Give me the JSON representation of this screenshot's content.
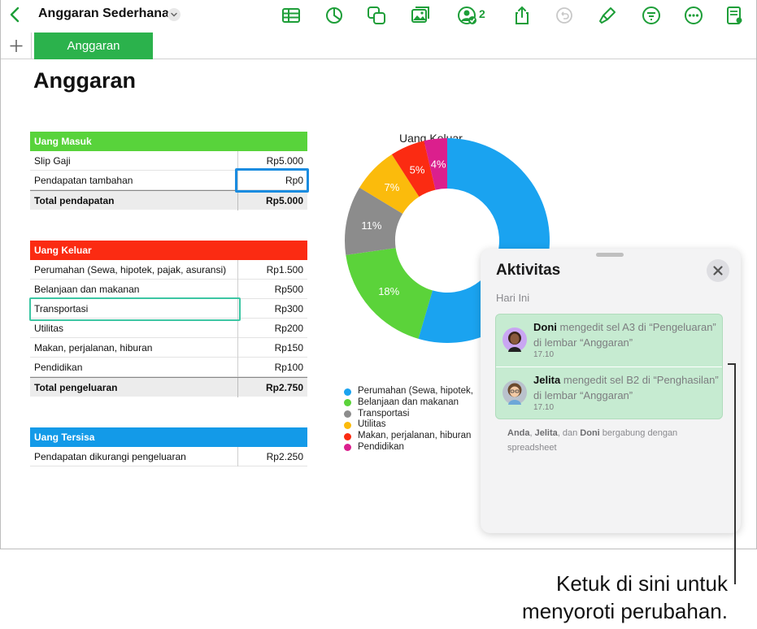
{
  "toolbar": {
    "doc_title": "Anggaran Sederhana",
    "collab_count": "2",
    "icons": [
      "back-icon",
      "table-icon",
      "chart-icon",
      "shape-icon",
      "media-icon",
      "collaborate-icon",
      "share-icon",
      "undo-icon",
      "format-brush-icon",
      "filter-icon",
      "more-icon",
      "document-view-icon"
    ],
    "accent": "#1d9e38"
  },
  "tabs": {
    "add_icon": "plus-icon",
    "active_label": "Anggaran"
  },
  "sheet_title": "Anggaran",
  "income": {
    "header": "Uang Masuk",
    "color": "#58d33b",
    "rows": [
      {
        "label": "Slip Gaji",
        "value": "Rp5.000"
      },
      {
        "label": "Pendapatan tambahan",
        "value": "Rp0"
      }
    ],
    "total": {
      "label": "Total pendapatan",
      "value": "Rp5.000"
    }
  },
  "expenses": {
    "header": "Uang Keluar",
    "color": "#fb2b12",
    "rows": [
      {
        "label": "Perumahan (Sewa, hipotek, pajak, asuransi)",
        "value": "Rp1.500"
      },
      {
        "label": "Belanjaan dan makanan",
        "value": "Rp500"
      },
      {
        "label": "Transportasi",
        "value": "Rp300"
      },
      {
        "label": "Utilitas",
        "value": "Rp200"
      },
      {
        "label": "Makan, perjalanan, hiburan",
        "value": "Rp150"
      },
      {
        "label": "Pendidikan",
        "value": "Rp100"
      }
    ],
    "total": {
      "label": "Total pengeluaran",
      "value": "Rp2.750"
    }
  },
  "remaining": {
    "header": "Uang Tersisa",
    "color": "#139ae8",
    "rows": [
      {
        "label": "Pendapatan dikurangi pengeluaran",
        "value": "Rp2.250"
      }
    ]
  },
  "chart_data": {
    "type": "pie",
    "title": "Uang Keluar",
    "donut": true,
    "categories": [
      "Perumahan (Sewa, hipotek,",
      "Belanjaan dan makanan",
      "Transportasi",
      "Utilitas",
      "Makan, perjalanan, hiburan",
      "Pendidikan"
    ],
    "values": [
      1500,
      500,
      300,
      200,
      150,
      100
    ],
    "data_labels": [
      "",
      "18%",
      "11%",
      "7%",
      "5%",
      "4%"
    ],
    "colors": [
      "#1aa3f0",
      "#5bd33a",
      "#8c8c8c",
      "#fbbb0c",
      "#fb2b12",
      "#db1f8d"
    ],
    "legend_position": "bottom-left"
  },
  "activity": {
    "title": "Aktivitas",
    "section": "Hari Ini",
    "entries": [
      {
        "name": "Doni",
        "text": "mengedit sel A3 di “Pengeluaran” di lembar “Anggaran”",
        "time": "17.10"
      },
      {
        "name": "Jelita",
        "text": "mengedit sel B2 di “Penghasilan” di lembar “Anggaran”",
        "time": "17.10"
      }
    ],
    "joined": {
      "n1": "Anda",
      "sep1": ", ",
      "n2": "Jelita",
      "sep2": ", dan ",
      "n3": "Doni",
      "rest": " bergabung dengan spreadsheet"
    }
  },
  "callout": {
    "line1": "Ketuk di sini untuk",
    "line2": "menyoroti perubahan."
  }
}
